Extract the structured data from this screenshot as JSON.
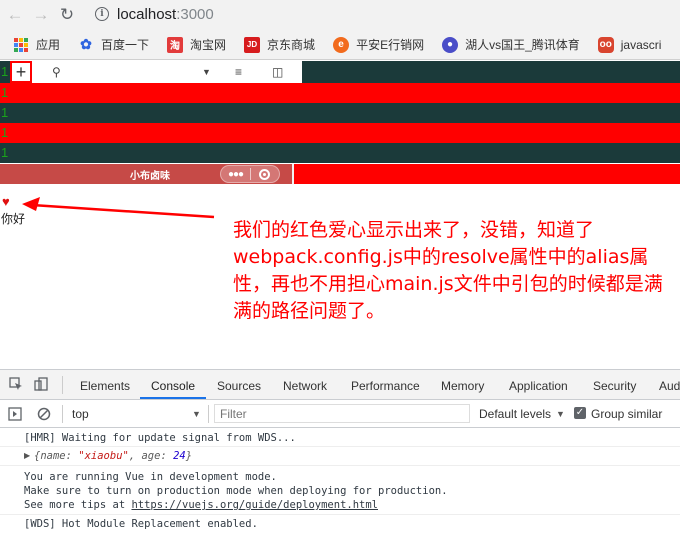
{
  "browser": {
    "url_host": "localhost",
    "url_port": ":3000"
  },
  "bookmarks": [
    {
      "label": "应用",
      "icon": "apps-grid-icon"
    },
    {
      "label": "百度一下",
      "icon": "baidu-paw-icon"
    },
    {
      "label": "淘宝网",
      "icon": "taobao-icon"
    },
    {
      "label": "京东商城",
      "icon": "jd-icon"
    },
    {
      "label": "平安E行销网",
      "icon": "pingan-icon"
    },
    {
      "label": "湖人vs国王_腾讯体育",
      "icon": "tencent-sports-icon"
    },
    {
      "label": "javascri",
      "icon": "owl-icon"
    }
  ],
  "page": {
    "line_numbers": [
      "1",
      "1",
      "1",
      "1",
      "1",
      "1"
    ],
    "miniprogram_title": "小布卤味",
    "heart": "♥",
    "greeting": "你好",
    "annotation": "我们的红色爱心显示出来了，没错，知道了webpack.config.js中的resolve属性中的alias属性，再也不用担心main.js文件中引包的时候都是满满的路径问题了。"
  },
  "devtools": {
    "tabs": [
      "Elements",
      "Console",
      "Sources",
      "Network",
      "Performance",
      "Memory",
      "Application",
      "Security",
      "Aud"
    ],
    "active_tab": "Console",
    "context": "top",
    "filter_placeholder": "Filter",
    "levels": "Default levels",
    "group_similar": "Group similar",
    "console": {
      "hmr": "[HMR] Waiting for update signal from WDS...",
      "obj_prefix": "{name: ",
      "obj_name": "\"xiaobu\"",
      "obj_mid": ", age: ",
      "obj_age": "24",
      "obj_suffix": "}",
      "vue_line1": "You are running Vue in development mode.",
      "vue_line2": "Make sure to turn on production mode when deploying for production.",
      "vue_line3_prefix": "See more tips at ",
      "vue_line3_link": "https://vuejs.org/guide/deployment.html",
      "wds": "[WDS] Hot Module Replacement enabled."
    }
  },
  "colors": {
    "stripe_red": "#ff0000",
    "stripe_dark": "#1b3a3a",
    "annotation": "#ff0000",
    "heart": "#e01010"
  }
}
